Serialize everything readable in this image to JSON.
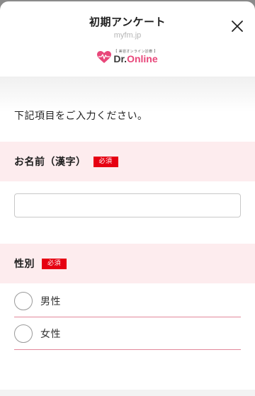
{
  "sheet": {
    "title": "初期アンケート",
    "domain": "myfm.jp"
  },
  "logo": {
    "tagline": "【 美容オンライン診療 】",
    "text_dr": "Dr.",
    "text_online": "Online",
    "icon": "heart-pulse-icon",
    "brand_color": "#e8477a"
  },
  "form": {
    "intro": "下記項目をご入力ください。",
    "name_section": {
      "label": "お名前（漢字）",
      "required": "必須",
      "input_value": "",
      "input_placeholder": ""
    },
    "gender_section": {
      "label": "性別",
      "required": "必須",
      "options": [
        {
          "label": "男性",
          "selected": false
        },
        {
          "label": "女性",
          "selected": false
        }
      ]
    }
  },
  "colors": {
    "required_badge": "#e60012",
    "section_bg": "#fdecee",
    "divider": "#e2899b"
  }
}
